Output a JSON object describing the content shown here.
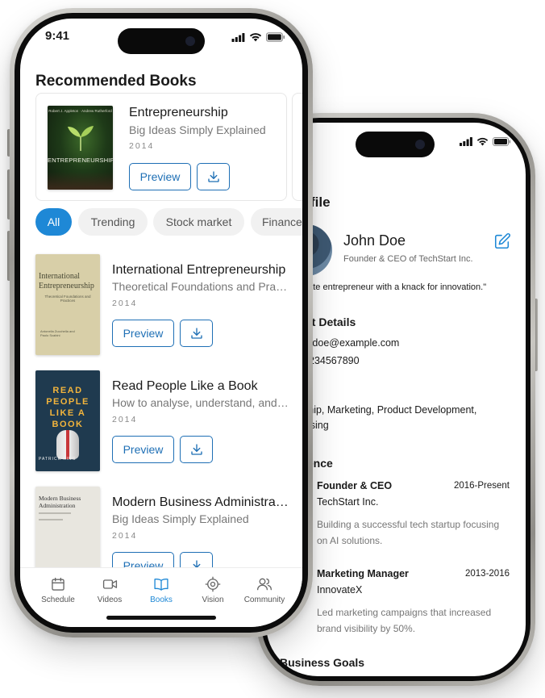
{
  "front": {
    "status": {
      "time": "9:41"
    },
    "section_title": "Recommended Books",
    "featured": {
      "title": "Entrepreneurship",
      "subtitle": "Big Ideas Simply Explained",
      "year": "2014",
      "preview_label": "Preview",
      "cover_text": "ENTREPRENEURSHIP",
      "cover_authors": "Robert J. Appleton · Andrew Rutherford"
    },
    "filters": [
      {
        "label": "All",
        "active": true
      },
      {
        "label": "Trending"
      },
      {
        "label": "Stock market"
      },
      {
        "label": "Finance"
      }
    ],
    "books": [
      {
        "title": "International Entrepreneurship",
        "subtitle": "Theoretical Foundations and Practices",
        "year": "2014",
        "preview_label": "Preview",
        "cover_title": "International Entrepreneurship",
        "cover_sub": "Theoretical Foundations and Practices",
        "cover_authors": "Antonella Zucchella and Paolo Scabini"
      },
      {
        "title": "Read People Like a Book",
        "subtitle": "How to analyse, understand, and predict people's emotions",
        "year": "2014",
        "preview_label": "Preview",
        "cover_title": "READ PEOPLE LIKE A BOOK",
        "cover_author": "PATRICK KING"
      },
      {
        "title": "Modern Business Administration",
        "subtitle": "Big Ideas Simply Explained",
        "year": "2014",
        "preview_label": "Preview",
        "cover_title": "Modern Business Administration"
      }
    ],
    "tabs": [
      {
        "label": "Schedule",
        "icon": "calendar-icon"
      },
      {
        "label": "Videos",
        "icon": "video-icon"
      },
      {
        "label": "Books",
        "icon": "book-icon",
        "active": true
      },
      {
        "label": "Vision",
        "icon": "target-icon"
      },
      {
        "label": "Community",
        "icon": "users-icon"
      }
    ]
  },
  "back": {
    "page_title": "rofile",
    "name": "John Doe",
    "role": "Founder & CEO of TechStart Inc.",
    "quote": "nate entrepreneur with a knack for innovation.\"",
    "contact_heading": "ct Details",
    "email": "e.doe@example.com",
    "phone": "234567890",
    "skills_line1": "ship, Marketing, Product Development,",
    "skills_line2": "ising",
    "experience_heading": "ience",
    "experience": [
      {
        "title": "Founder & CEO",
        "dates": "2016-Present",
        "company": "TechStart Inc.",
        "description": "Building a successful tech startup focusing on AI solutions."
      },
      {
        "title": "Marketing Manager",
        "dates": "2013-2016",
        "company": "InnovateX",
        "description": "Led marketing campaigns that increased brand visibility by 50%."
      }
    ],
    "goals_heading": "Business Goals"
  },
  "colors": {
    "accent": "#1e88d6",
    "button_border": "#1e6fb5"
  }
}
